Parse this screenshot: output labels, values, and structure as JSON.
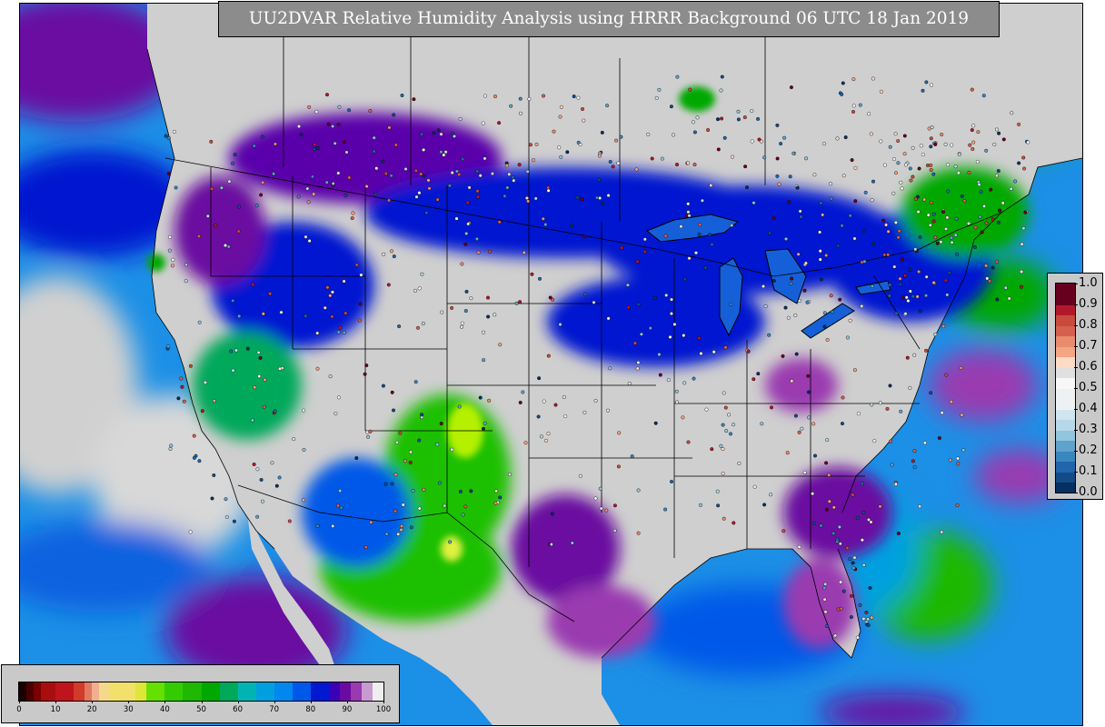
{
  "title": "UU2DVAR Relative Humidity Analysis using HRRR Background 06 UTC 18 Jan 2019",
  "rh_colorbar": {
    "ticks": [
      "0",
      "10",
      "20",
      "30",
      "40",
      "50",
      "60",
      "70",
      "80",
      "90",
      "100"
    ],
    "min": 0,
    "max": 100,
    "bands": [
      {
        "from": 0,
        "to": 2,
        "color": "#1a0000"
      },
      {
        "from": 2,
        "to": 4,
        "color": "#4a0000"
      },
      {
        "from": 4,
        "to": 6,
        "color": "#7a0000"
      },
      {
        "from": 6,
        "to": 10,
        "color": "#a80e0e"
      },
      {
        "from": 10,
        "to": 15,
        "color": "#c0141c"
      },
      {
        "from": 15,
        "to": 18,
        "color": "#d23a2a"
      },
      {
        "from": 18,
        "to": 20,
        "color": "#e27860"
      },
      {
        "from": 20,
        "to": 22,
        "color": "#f0b090"
      },
      {
        "from": 22,
        "to": 25,
        "color": "#f5d98a"
      },
      {
        "from": 25,
        "to": 32,
        "color": "#f1e06a"
      },
      {
        "from": 32,
        "to": 35,
        "color": "#dfe63a"
      },
      {
        "from": 35,
        "to": 40,
        "color": "#66e000"
      },
      {
        "from": 40,
        "to": 45,
        "color": "#33cc00"
      },
      {
        "from": 45,
        "to": 50,
        "color": "#1fb800"
      },
      {
        "from": 50,
        "to": 55,
        "color": "#00a800"
      },
      {
        "from": 55,
        "to": 60,
        "color": "#00a85a"
      },
      {
        "from": 60,
        "to": 65,
        "color": "#00b4b4"
      },
      {
        "from": 65,
        "to": 70,
        "color": "#00a0e0"
      },
      {
        "from": 70,
        "to": 75,
        "color": "#0088ee"
      },
      {
        "from": 75,
        "to": 80,
        "color": "#0058e8"
      },
      {
        "from": 80,
        "to": 85,
        "color": "#0018d0"
      },
      {
        "from": 85,
        "to": 88,
        "color": "#3a00b8"
      },
      {
        "from": 88,
        "to": 91,
        "color": "#6a0aa0"
      },
      {
        "from": 91,
        "to": 94,
        "color": "#9a3ab0"
      },
      {
        "from": 94,
        "to": 97,
        "color": "#c89ad0"
      },
      {
        "from": 97,
        "to": 100,
        "color": "#eeeeee"
      }
    ]
  },
  "ob_colorbar": {
    "ticks": [
      "0.0",
      "0.1",
      "0.2",
      "0.3",
      "0.4",
      "0.5",
      "0.6",
      "0.7",
      "0.8",
      "0.9",
      "1.0"
    ],
    "min": 0,
    "max": 1,
    "bands": [
      {
        "from": 0.0,
        "to": 0.05,
        "color": "#053061"
      },
      {
        "from": 0.05,
        "to": 0.1,
        "color": "#134b87"
      },
      {
        "from": 0.1,
        "to": 0.15,
        "color": "#2166ac"
      },
      {
        "from": 0.15,
        "to": 0.2,
        "color": "#3a87bd"
      },
      {
        "from": 0.2,
        "to": 0.25,
        "color": "#5fa2cb"
      },
      {
        "from": 0.25,
        "to": 0.3,
        "color": "#92c5de"
      },
      {
        "from": 0.3,
        "to": 0.35,
        "color": "#b7d8e8"
      },
      {
        "from": 0.35,
        "to": 0.4,
        "color": "#d1e5f0"
      },
      {
        "from": 0.4,
        "to": 0.5,
        "color": "#eef1f4"
      },
      {
        "from": 0.5,
        "to": 0.55,
        "color": "#f7f7f7"
      },
      {
        "from": 0.55,
        "to": 0.6,
        "color": "#e0e0e0"
      },
      {
        "from": 0.6,
        "to": 0.65,
        "color": "#fddbc7"
      },
      {
        "from": 0.65,
        "to": 0.7,
        "color": "#f4a582"
      },
      {
        "from": 0.7,
        "to": 0.75,
        "color": "#e88b6e"
      },
      {
        "from": 0.75,
        "to": 0.8,
        "color": "#d6604d"
      },
      {
        "from": 0.8,
        "to": 0.85,
        "color": "#c94a3c"
      },
      {
        "from": 0.85,
        "to": 0.9,
        "color": "#b2182b"
      },
      {
        "from": 0.9,
        "to": 1.0,
        "color": "#67001f"
      }
    ]
  },
  "map": {
    "ocean_color": "#1c8fe6",
    "deep_ocean_color": "#0a62e0",
    "land_dry_color": "#cfcfcf",
    "moist_color": "#0018d0",
    "very_moist_color": "#5a00aa",
    "green_color": "#1fc000",
    "bright_green_color": "#7cf000"
  }
}
